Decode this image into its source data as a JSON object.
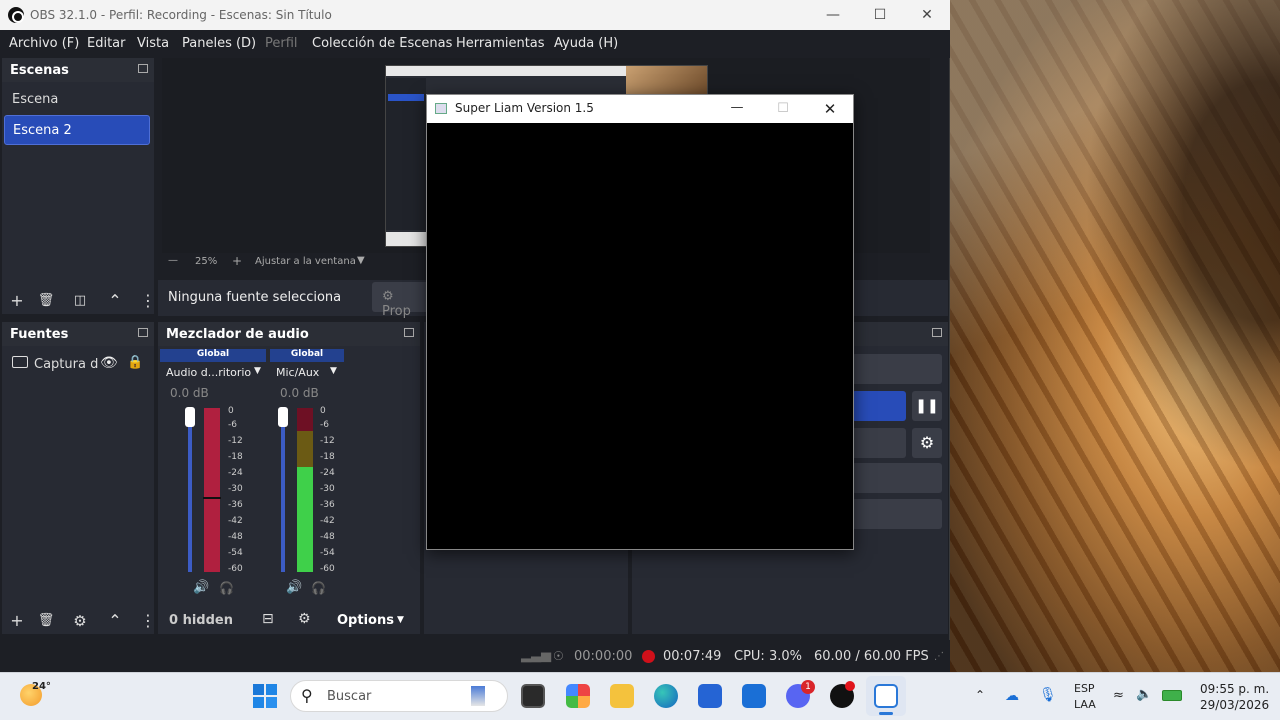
{
  "obs": {
    "title": "OBS 32.1.0 - Perfil: Recording - Escenas: Sin Título",
    "menu": [
      "Archivo (F)",
      "Editar",
      "Vista",
      "Paneles (D)",
      "Perfil",
      "Colección de Escenas",
      "Herramientas",
      "Ayuda (H)"
    ],
    "scenes": {
      "header": "Escenas",
      "items": [
        "Escena",
        "Escena 2"
      ],
      "selected": "Escena 2"
    },
    "preview": {
      "zoom": "25%",
      "fit_label": "Ajustar a la ventana"
    },
    "source_bar": {
      "none_selected": "Ninguna fuente selecciona",
      "properties": "Prop"
    },
    "sources": {
      "header": "Fuentes",
      "items": [
        {
          "label": "Captura d"
        }
      ]
    },
    "mixer": {
      "header": "Mezclador de audio",
      "channels": [
        {
          "badge": "Global",
          "name": "Audio d...ritorio",
          "db": "0.0 dB"
        },
        {
          "badge": "Global",
          "name": "Mic/Aux",
          "db": "0.0 dB"
        }
      ],
      "ticks": [
        "0",
        "-6",
        "-12",
        "-18",
        "-24",
        "-30",
        "-36",
        "-42",
        "-48",
        "-54",
        "-60"
      ],
      "hidden": "0 hidden",
      "options": "Options"
    },
    "status": {
      "stream_time": "00:00:00",
      "rec_time": "00:07:49",
      "cpu": "CPU: 3.0%",
      "fps": "60.00 / 60.00 FPS"
    }
  },
  "game_window": {
    "title": "Super Liam Version 1.5"
  },
  "taskbar": {
    "weather_temp": "24°",
    "search_placeholder": "Buscar",
    "lang_top": "ESP",
    "lang_bottom": "LAA",
    "time": "09:55 p. m.",
    "date": "29/03/2026",
    "discord_badge": "1"
  },
  "colors": {
    "accent": "#284cb8",
    "record_red": "#d0101a",
    "meter_green": "#3fd04a",
    "meter_red": "#b0203f"
  }
}
